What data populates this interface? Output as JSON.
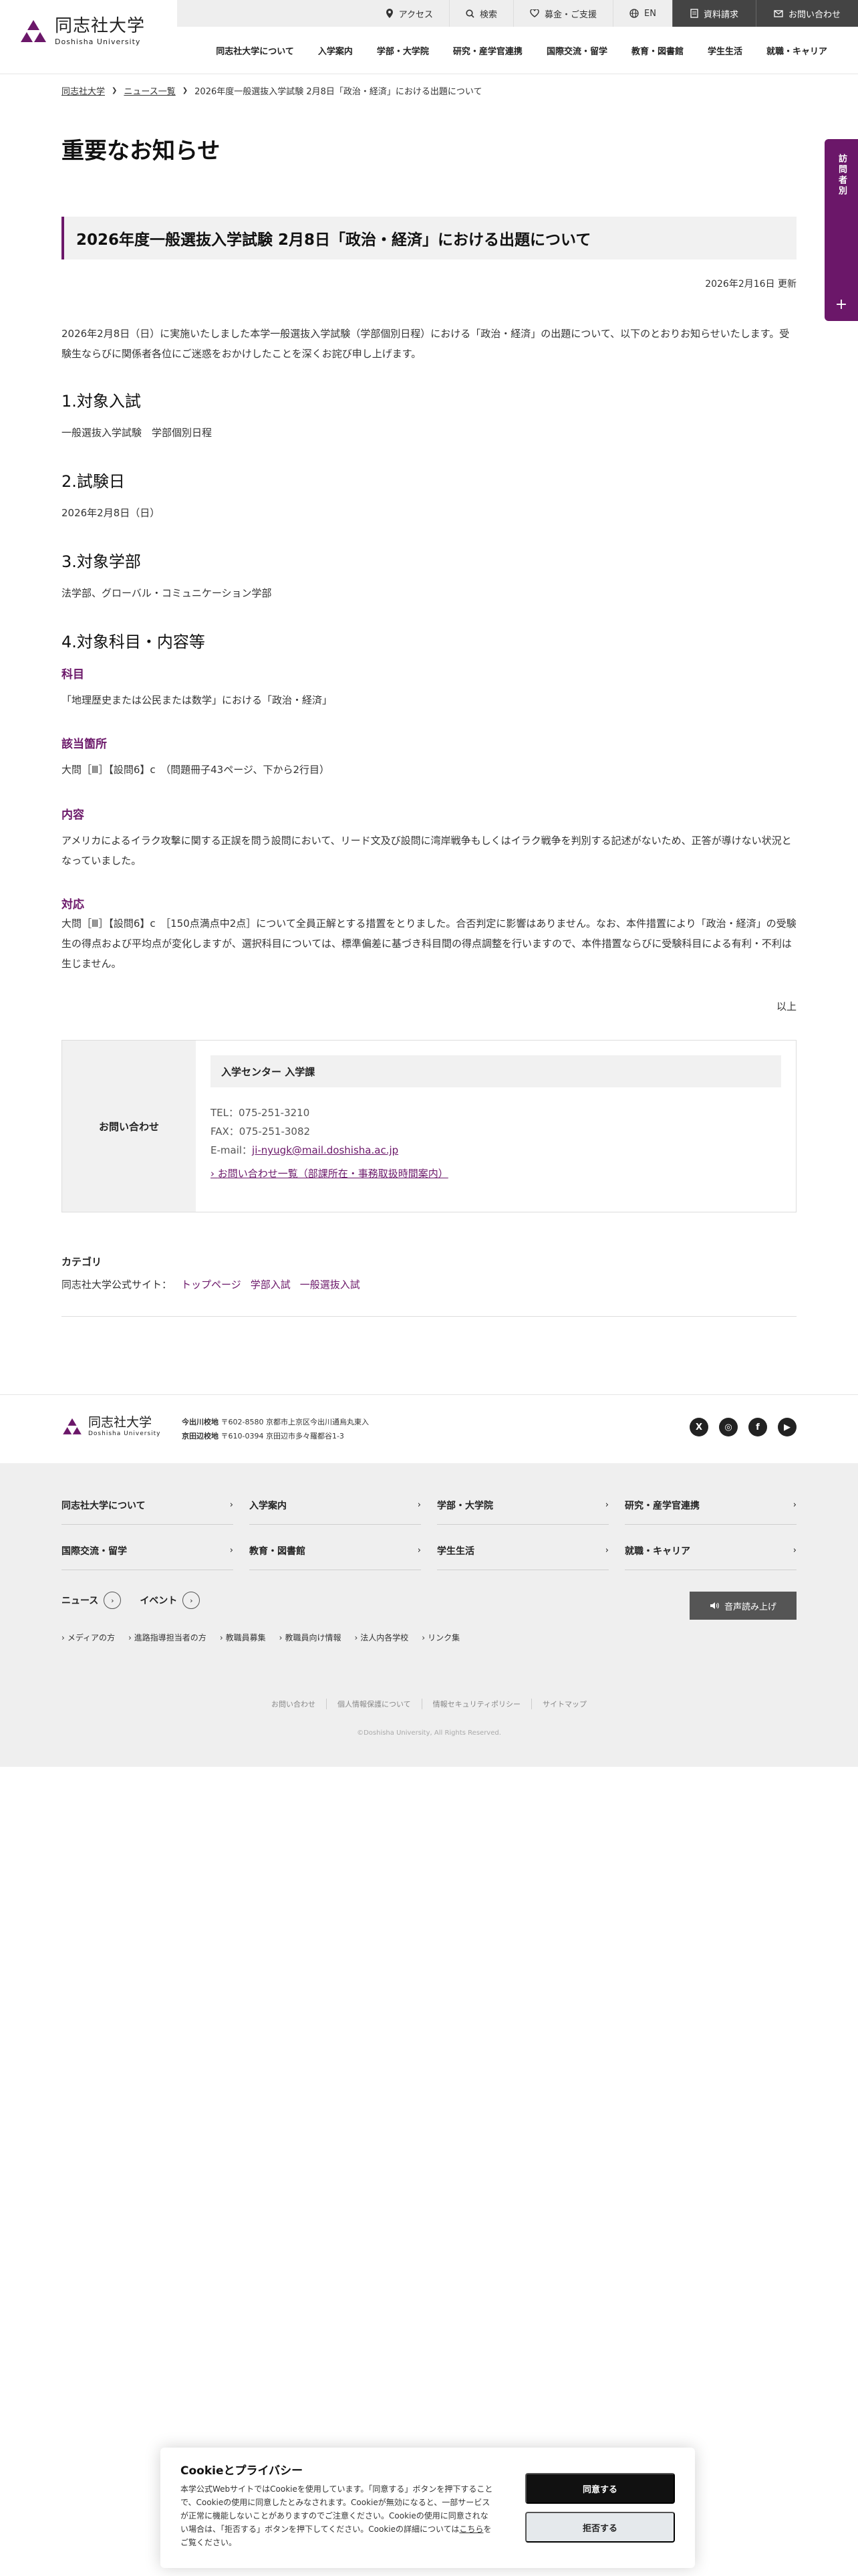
{
  "header": {
    "logo_jp": "同志社大学",
    "logo_en": "Doshisha University",
    "top_links": [
      {
        "label": "アクセス",
        "icon": "pin-icon"
      },
      {
        "label": "検索",
        "icon": "search-icon"
      },
      {
        "label": "募金・ご支援",
        "icon": "heart-icon"
      },
      {
        "label": "EN",
        "icon": "globe-icon"
      }
    ],
    "top_buttons": [
      {
        "label": "資料請求",
        "icon": "document-icon"
      },
      {
        "label": "お問い合わせ",
        "icon": "mail-icon"
      }
    ],
    "nav": [
      "同志社大学について",
      "入学案内",
      "学部・大学院",
      "研究・産学官連携",
      "国際交流・留学",
      "教育・図書館",
      "学生生活",
      "就職・キャリア"
    ]
  },
  "breadcrumb": {
    "home": "同志社大学",
    "list": "ニュース一覧",
    "current": "2026年度一般選抜入学試験 2月8日「政治・経済」における出題について"
  },
  "page_title": "重要なお知らせ",
  "side_tab": {
    "label": "訪問者別",
    "plus": "+"
  },
  "article": {
    "title": "2026年度一般選抜入学試験 2月8日「政治・経済」における出題について",
    "updated": "2026年2月16日 更新",
    "intro": "2026年2月8日（日）に実施いたしました本学一般選抜入学試験（学部個別日程）における「政治・経済」の出題について、以下のとおりお知らせいたします。受験生ならびに関係者各位にご迷惑をおかけしたことを深くお詫び申し上げます。",
    "s1_title": "1.対象入試",
    "s1_body": "一般選抜入学試験　学部個別日程",
    "s2_title": "2.試験日",
    "s2_body": "2026年2月8日（日）",
    "s3_title": "3.対象学部",
    "s3_body": "法学部、グローバル・コミュニケーション学部",
    "s4_title": "4.対象科目・内容等",
    "subject_label": "科目",
    "subject_body": "「地理歴史または公民または数学」における「政治・経済」",
    "place_label": "該当箇所",
    "place_body": "大問［Ⅲ］【設問6】c　（問題冊子43ページ、下から2行目）",
    "content_label": "内容",
    "content_body": "アメリカによるイラク攻撃に関する正誤を問う設問において、リード文及び設問に湾岸戦争もしくはイラク戦争を判別する記述がないため、正答が導けない状況となっていました。",
    "response_label": "対応",
    "response_body": "大問［Ⅲ］【設問6】c　［150点満点中2点］について全員正解とする措置をとりました。合否判定に影響はありません。なお、本件措置により「政治・経済」の受験生の得点および平均点が変化しますが、選択科目については、標準偏差に基づき科目間の得点調整を行いますので、本件措置ならびに受験科目による有利・不利は生じません。",
    "end_note": "以上"
  },
  "contact": {
    "label": "お問い合わせ",
    "dept": "入学センター 入学課",
    "tel": "TEL：075-251-3210",
    "fax": "FAX：075-251-3082",
    "email_prefix": "E-mail：",
    "email": "ji-nyugk@mail.doshisha.ac.jp",
    "more": "お問い合わせ一覧（部課所在・事務取扱時間案内）"
  },
  "category": {
    "title": "カテゴリ",
    "site_label": "同志社大学公式サイト：",
    "tags": [
      "トップページ",
      "学部入試",
      "一般選抜入試"
    ]
  },
  "footer": {
    "logo_jp": "同志社大学",
    "logo_en": "Doshisha University",
    "campus1_name": "今出川校地",
    "campus1_addr": "〒602-8580 京都市上京区今出川通烏丸東入",
    "campus2_name": "京田辺校地",
    "campus2_addr": "〒610-0394 京田辺市多々羅都谷1-3",
    "social": [
      {
        "label": "X",
        "icon": "x-icon"
      },
      {
        "label": "◎",
        "icon": "instagram-icon"
      },
      {
        "label": "f",
        "icon": "facebook-icon"
      },
      {
        "label": "▶",
        "icon": "youtube-icon"
      }
    ],
    "nav_row1": [
      "同志社大学について",
      "入学案内",
      "学部・大学院",
      "研究・産学官連携"
    ],
    "nav_row2": [
      "国際交流・留学",
      "教育・図書館",
      "学生生活",
      "就職・キャリア"
    ],
    "news": "ニュース",
    "events": "イベント",
    "voice": "音声読み上げ",
    "sub_links": [
      "メディアの方",
      "進路指導担当者の方",
      "教職員募集",
      "教職員向け情報",
      "法人内各学校",
      "リンク集"
    ],
    "legal": [
      "お問い合わせ",
      "個人情報保護について",
      "情報セキュリティポリシー",
      "サイトマップ"
    ],
    "copyright": "©Doshisha University, All Rights Reserved."
  },
  "cookie": {
    "title": "Cookieとプライバシー",
    "text": "本学公式WebサイトではCookieを使用しています。「同意する」ボタンを押下することで、Cookieの使用に同意したとみなされます。Cookieが無効になると、一部サービスが正常に機能しないことがありますのでご注意ください。Cookieの使用に同意されない場合は、「拒否する」ボタンを押下してください。Cookieの詳細については",
    "link": "こちら",
    "text_end": "をご覧ください。",
    "accept": "同意する",
    "reject": "拒否する"
  },
  "colors": {
    "accent": "#6b1769",
    "dark_button": "#444444",
    "footer_bg": "#efefef"
  }
}
